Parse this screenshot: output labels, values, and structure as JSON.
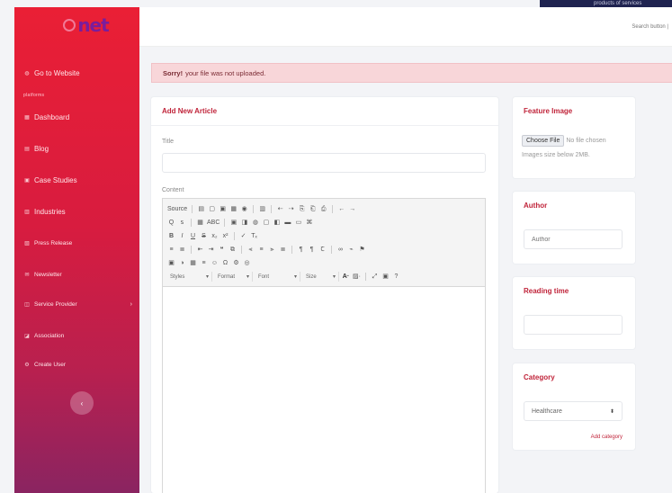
{
  "banner": {
    "text": "products of services"
  },
  "brand": {
    "logo_text": "net"
  },
  "sidebar": {
    "section_label": "platforms",
    "items": [
      {
        "label": "Go to Website",
        "icon": "globe-icon"
      },
      {
        "label": "Dashboard",
        "icon": "dashboard-icon"
      },
      {
        "label": "Blog",
        "icon": "blog-icon"
      },
      {
        "label": "Case Studies",
        "icon": "case-icon"
      },
      {
        "label": "Industries",
        "icon": "industry-icon"
      },
      {
        "label": "Press Release",
        "icon": "press-icon"
      },
      {
        "label": "Newsletter",
        "icon": "newsletter-icon"
      },
      {
        "label": "Service Provider",
        "icon": "provider-icon",
        "chevron": "›"
      },
      {
        "label": "Association",
        "icon": "association-icon"
      },
      {
        "label": "Create User",
        "icon": "user-add-icon"
      }
    ],
    "collapse_symbol": "‹"
  },
  "header": {
    "user_text": "Search button |"
  },
  "alert": {
    "strong": "Sorry!",
    "message": "your file was not uploaded."
  },
  "article": {
    "title": "Add New Article",
    "title_label": "Title",
    "content_label": "Content"
  },
  "editor": {
    "row1": [
      "Source",
      "▤",
      "▢",
      "▣",
      "▦",
      "◉",
      "▥",
      "⇠",
      "⇢",
      "⎘",
      "⎗",
      "⎙",
      "←",
      "→"
    ],
    "row2": [
      "Q",
      "ꜱ",
      "▦",
      "ABC",
      "▣",
      "◨",
      "◍",
      "▢",
      "◧",
      "▬",
      "▭",
      "⌘"
    ],
    "row3": [
      "B",
      "I",
      "U",
      "S",
      "x₂",
      "x²",
      "✓",
      "Tₓ"
    ],
    "row4": [
      "≡",
      "≣",
      "⇤",
      "⇥",
      "❝",
      "⧉",
      "⫷",
      "≡",
      "⫸",
      "≣",
      "¶",
      "¶",
      "Ꞇ",
      "∞",
      "⌁",
      "⚑"
    ],
    "row5": [
      "▣",
      "◑",
      "▦",
      "≡",
      "☺",
      "Ω",
      "⚙",
      "◎"
    ],
    "styles": "Styles",
    "format": "Format",
    "font": "Font",
    "size": "Size",
    "extra": [
      "A·",
      "▨·",
      "⤢",
      "▣",
      "?"
    ]
  },
  "feature": {
    "title": "Feature Image",
    "file_button": "Choose File",
    "file_status": "No file chosen",
    "hint": "Images size below 2MB."
  },
  "author": {
    "title": "Author",
    "placeholder": "Author"
  },
  "reading": {
    "title": "Reading time",
    "value": ""
  },
  "category": {
    "title": "Category",
    "selected": "Healthcare",
    "add_link": "Add category"
  }
}
